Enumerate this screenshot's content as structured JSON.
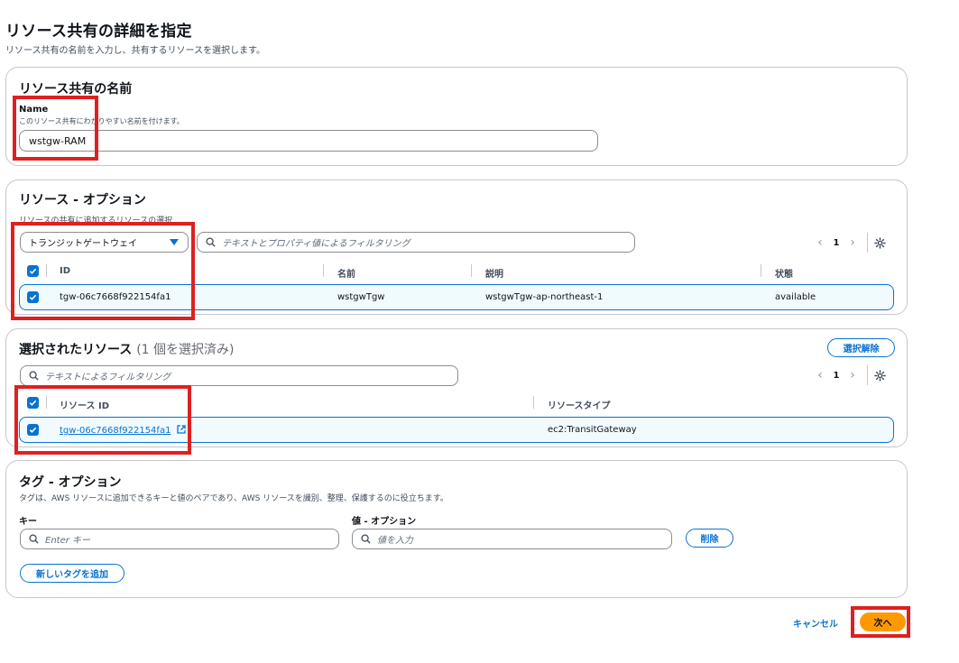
{
  "page": {
    "title": "リソース共有の詳細を指定",
    "description": "リソース共有の名前を入力し、共有するリソースを選択します。"
  },
  "name_section": {
    "heading": "リソース共有の名前",
    "field_label": "Name",
    "field_hint": "このリソース共有にわかりやすい名前を付けます。",
    "field_value": "wstgw-RAM"
  },
  "resources_section": {
    "heading": "リソース - オプション",
    "hint": "リソースの共有に追加するリソースの選択",
    "type_select_value": "トランジットゲートウェイ",
    "filter_placeholder": "テキストとプロパティ値によるフィルタリング",
    "page_number": "1",
    "columns": [
      "ID",
      "名前",
      "説明",
      "状態"
    ],
    "rows": [
      {
        "id": "tgw-06c7668f922154fa1",
        "name": "wstgwTgw",
        "description": "wstgwTgw-ap-northeast-1",
        "state": "available",
        "selected": true
      }
    ]
  },
  "selected_section": {
    "heading": "選択されたリソース",
    "count_text": "(1 個を選択済み)",
    "deselect_button": "選択解除",
    "filter_placeholder": "テキストによるフィルタリング",
    "page_number": "1",
    "columns": [
      "リソース ID",
      "リソースタイプ"
    ],
    "rows": [
      {
        "resource_id": "tgw-06c7668f922154fa1",
        "resource_type": "ec2:TransitGateway",
        "selected": true
      }
    ]
  },
  "tags_section": {
    "heading": "タグ - オプション",
    "description": "タグは、AWS リソースに追加できるキーと値のペアであり、AWS リソースを識別、整理、保護するのに役立ちます。",
    "key_label": "キー",
    "value_label": "値 - オプション",
    "key_placeholder": "Enter キー",
    "value_placeholder": "値を入力",
    "remove_button": "削除",
    "add_tag_button": "新しいタグを追加"
  },
  "footer": {
    "cancel_label": "キャンセル",
    "next_label": "次へ"
  },
  "colors": {
    "accent": "#0972d3",
    "primary_button": "#ff9900",
    "highlight_box": "#e02020",
    "selected_row_bg": "#f1faff"
  }
}
